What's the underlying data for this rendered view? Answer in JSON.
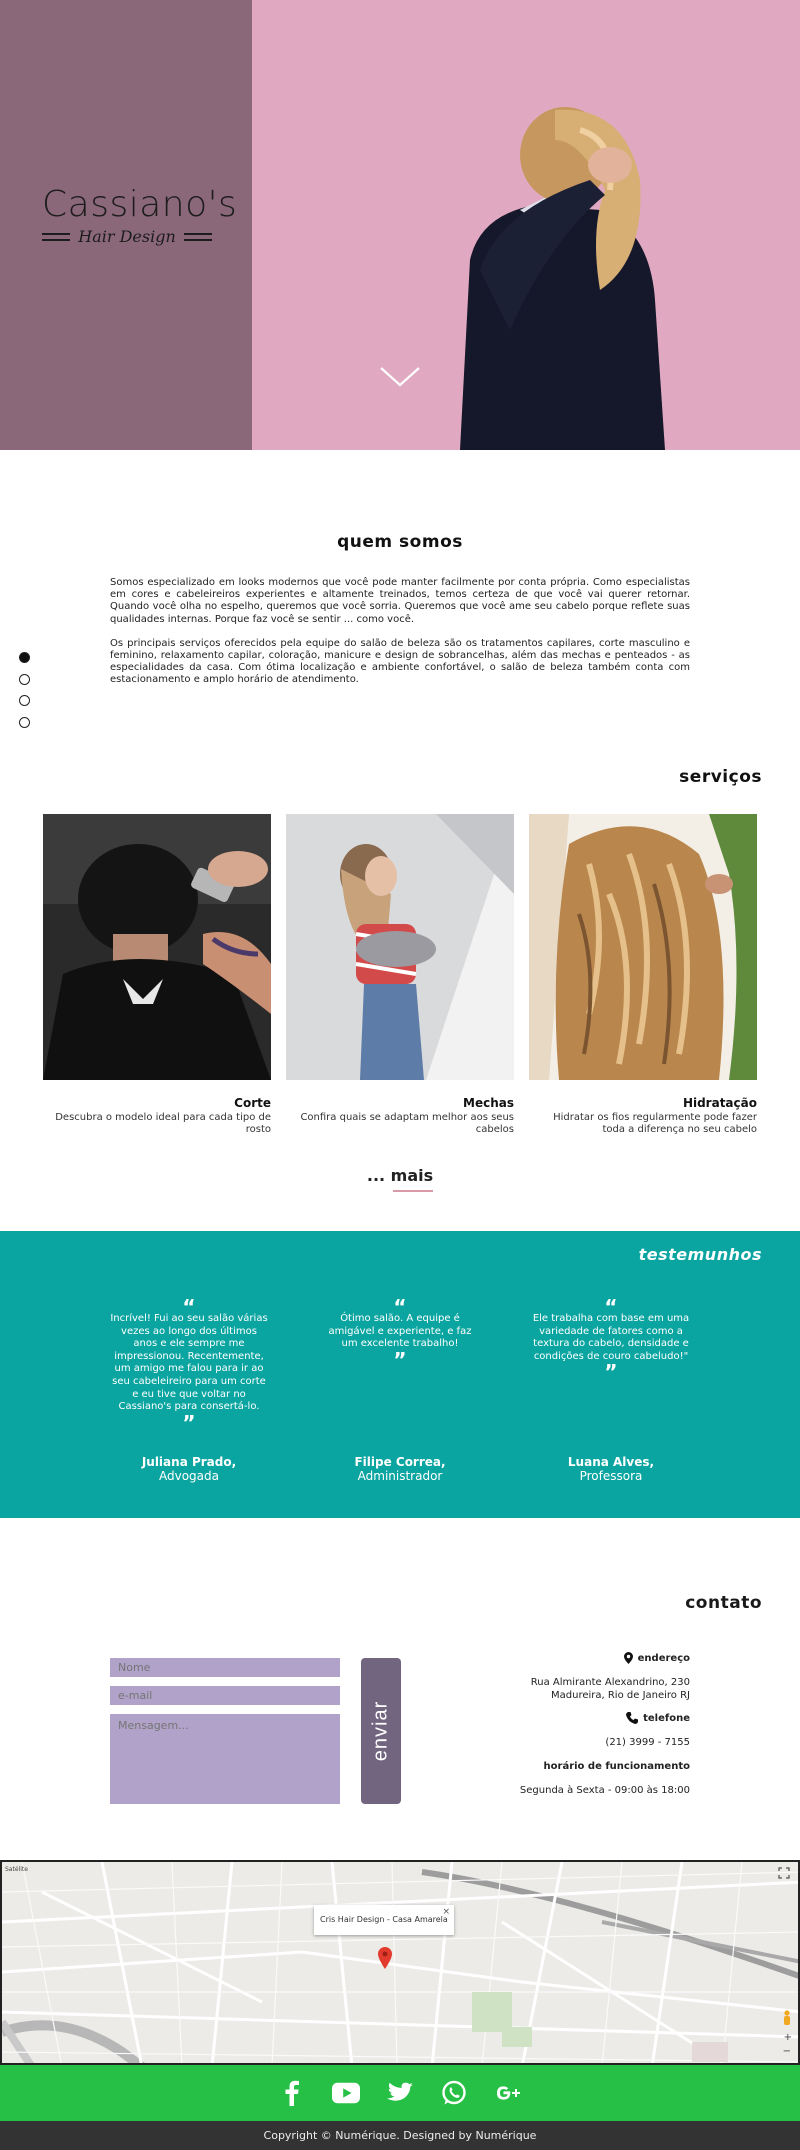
{
  "brand": {
    "name": "Cassiano's",
    "tagline": "Hair Design",
    "colors": {
      "hero_bg": "#e1a9c1",
      "hero_panel": "#8a6779",
      "teal": "#0ba5a1",
      "green": "#27c046",
      "field": "#b0a2c8",
      "button": "#72657f"
    }
  },
  "hero": {
    "scroll_icon": "chevron-down-icon"
  },
  "about": {
    "title": "quem somos",
    "paragraphs": [
      "Somos especializado em looks modernos que você pode manter facilmente por conta própria. Como especialistas em cores e cabeleireiros experientes e altamente treinados, temos certeza de que você vai querer retornar. Quando você olha no espelho, queremos que você sorria. Queremos que você ame seu cabelo porque reflete suas qualidades internas. Porque faz você se sentir ... como você.",
      "Os principais serviços oferecidos pela equipe do salão de beleza são os tratamentos capilares, corte masculino e feminino, relaxamento capilar, coloração, manicure e design de sobrancelhas, além das mechas e penteados - as especialidades da casa. Com ótima localização e ambiente confortável, o salão de beleza também conta com estacionamento e amplo horário de atendimento."
    ]
  },
  "services": {
    "title": "serviços",
    "items": [
      {
        "name": "Corte",
        "description": "Descubra o modelo ideal para cada tipo de rosto"
      },
      {
        "name": "Mechas",
        "description": "Confira quais se adaptam melhor aos seus cabelos"
      },
      {
        "name": "Hidratação",
        "description": "Hidratar os fios regularmente pode fazer toda a diferença no seu cabelo"
      }
    ],
    "more_label": "... mais"
  },
  "testimonials": {
    "title": "testemunhos",
    "open_quote": "“",
    "close_quote": "”",
    "items": [
      {
        "text": "Incrível! Fui ao seu salão várias vezes ao longo dos últimos anos e ele sempre me impressionou. Recentemente, um amigo me falou para ir ao seu cabeleireiro para um corte e eu tive que voltar no Cassiano's para consertá-lo.",
        "author": "Juliana Prado,",
        "role": "Advogada"
      },
      {
        "text": "Ótimo salão. A equipe é amigável e experiente, e faz um excelente trabalho!",
        "author": "Filipe Correa,",
        "role": "Administrador"
      },
      {
        "text": "Ele trabalha com base em uma variedade de fatores como a textura do cabelo, densidade e condições de couro cabeludo!\"",
        "author": "Luana Alves,",
        "role": "Professora"
      }
    ]
  },
  "contact": {
    "title": "contato",
    "form": {
      "name_placeholder": "Nome",
      "email_placeholder": "e-mail",
      "message_placeholder": "Mensagem...",
      "submit_label": "enviar"
    },
    "address_label": "endereço",
    "address_lines": [
      "Rua Almirante Alexandrino, 230",
      "Madureira, Rio de Janeiro RJ"
    ],
    "phone_label": "telefone",
    "phone": "(21) 3999 - 7155",
    "hours_label": "horário de funcionamento",
    "hours": "Segunda à Sexta - 09:00 às 18:00"
  },
  "map": {
    "popup_title": "Cris Hair Design - Casa Amarela",
    "close_label": "×",
    "corner_label": "Satélite"
  },
  "social": [
    "facebook-icon",
    "youtube-icon",
    "twitter-icon",
    "whatsapp-icon",
    "google-plus-icon"
  ],
  "footer": {
    "copyright": "Copyright © Numérique. Designed by Numérique"
  }
}
